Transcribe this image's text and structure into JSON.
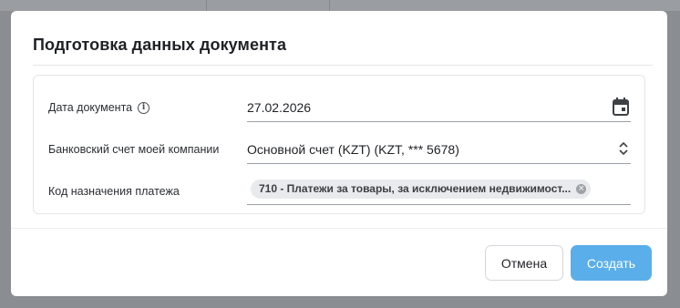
{
  "dialog": {
    "title": "Подготовка данных документа"
  },
  "form": {
    "document_date": {
      "label": "Дата документа",
      "value": "27.02.2026",
      "info_icon": "info-icon",
      "picker_icon": "calendar-icon"
    },
    "bank_account": {
      "label": "Банковский счет моей компании",
      "value": "Основной счет (KZT) (KZT, *** 5678)",
      "selector_icon": "chevron-up-down-icon"
    },
    "payment_purpose_code": {
      "label": "Код назначения платежа",
      "chip": "710 - Платежи за товары, за исключением недвижимост...",
      "chip_remove_icon": "close-icon"
    }
  },
  "footer": {
    "cancel_label": "Отмена",
    "create_label": "Создать"
  },
  "colors": {
    "overlay": "#8a8d91",
    "primary_button": "#5aaeea",
    "chip_background": "#e8eaed"
  }
}
